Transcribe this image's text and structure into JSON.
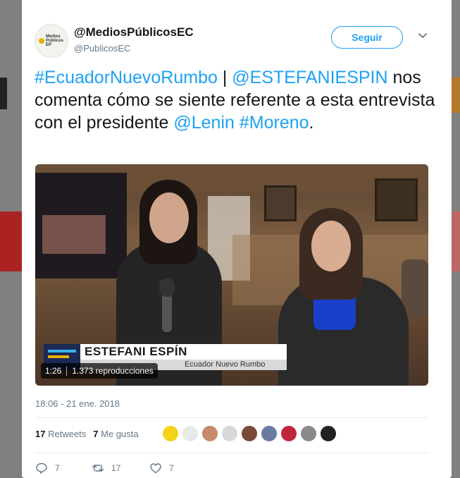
{
  "tweet": {
    "display_name": "@MediosPúblicosEC",
    "handle": "@PublicosEC",
    "follow_label": "Seguir",
    "avatar_logo_text": "Medios Públicos EP",
    "text_parts": {
      "hashtag1": "#EcuadorNuevoRumbo",
      "separator": " | ",
      "mention1": "@ESTEFANIESPIN",
      "body": " nos comenta cómo se siente referente a esta entrevista con el presidente ",
      "mention2": "@Lenin",
      "space": " ",
      "hashtag2": "#Moreno",
      "end": "."
    },
    "media": {
      "lower_third_name": "ESTEFANI ESPÍN",
      "lower_third_show": "Ecuador Nuevo Rumbo",
      "duration": "1:26",
      "views": "1.373 reproducciones"
    },
    "timestamp": "18:06 - 21 ene. 2018",
    "stats": {
      "retweets_count": "17",
      "retweets_label": "Retweets",
      "likes_count": "7",
      "likes_label": "Me gusta"
    },
    "actions": {
      "reply_count": "7",
      "retweet_count": "17",
      "like_count": "7"
    }
  },
  "colors": {
    "accent": "#1da1f2",
    "secondary_text": "#657786",
    "overlay": "#7a7a7a"
  },
  "icons": [
    "chevron-down-icon",
    "reply-icon",
    "retweet-icon",
    "heart-icon"
  ]
}
